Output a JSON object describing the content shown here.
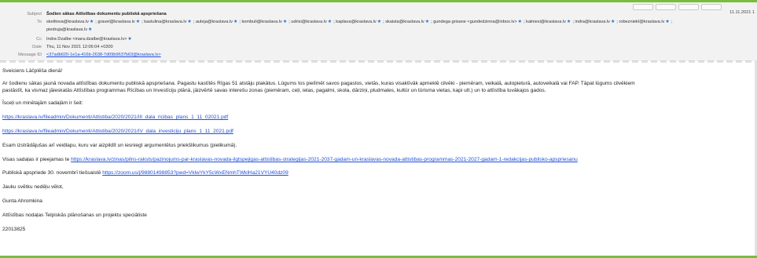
{
  "header": {
    "subject_label": "Subject",
    "subject": "Šodien sākas Attīstības dokumentu publiskā apspriešana",
    "date_right": "11.11.2021 1",
    "to_label": "To",
    "to_recipients": [
      "skelitova@kraslava.lv",
      "gravel@kraslava.lv",
      "kastulina@kraslava.lv",
      "auleja@kraslava.lv",
      "kombuli@kraslava.lv",
      "udrisi@kraslava.lv",
      "kaplava@kraslava.lv",
      "skaista@kraslava.lv",
      "gundega grisane <gundedzinna@inbox.lv>",
      "kalniesi@kraslava.lv",
      "indra@kraslava.lv",
      "robezniekI@kraslava.lv"
    ],
    "to_recipients_line2": [
      "piedruja@kraslava.lv"
    ],
    "cc_label": "Cc",
    "cc_value": "Indra Dzalbe <inara.dzalbe@kraslava.lv>",
    "date_label": "Date",
    "date_value": "Thu, 11 Nov 2021 12:06:04 +0200",
    "message_id_label": "Message ID",
    "message_id_value": "<37adb620-1e1a-416b-2638-7d09b9637b63@kraslava.lv>"
  },
  "body": {
    "greeting": "Sveiciens Lāčplēša dienā!",
    "para1_line1": "Ar šodienu sākas jaunā novada attīstības dokumentu publiskā apspriešana. Pagastu kastītēs Rīgas 51 atstāju plakātus. Lūgums tos pielīmēt savos pagastos, vietās, kuras visaktīvāk apmeklē cilvēki - piemēram,  veikalā, autopieturā, autoveikalā vai FAP. Tāpat lūgums cilvēkiem",
    "para1_line2": "pastāstīt, ka vismaz jāieskatās Attīstības programmas Rīcības un Investīciju plānā, jāizvērtē savas intereš­u zonas (piemēram, ceļi, ielas, pagalmi, skola, dārziņi, pludmales, kultūr un tūrisma vietas, kapi utt.) un to attīstība tuvākajos gados.",
    "short_intro": "Īsceļi un minētajām sadaļām ir šeit:",
    "link1": "https://kraslava.lv/fileadmin/Dokumenti/Attistiba/2020/2021/III_dala_ricibas_plans_1_11_02021.pdf",
    "link2": "https://kraslava.lv/fileadmin/Dokumenti/Attistiba/2020/2021/IV_dala_investiciju_plans_1_11_2021.pdf",
    "para2": "Esam izstrādājušas arī veidlapu, kuru var aizpildīt un iesniegt argumentētus priekšlikumus (pielikumā).",
    "visas_prefix": "Visas sadaļas ir pieejamas te ",
    "link3": "https://kraslava.lv/zinas/pilns-raksts/pazinojums-par-kraslavas-novada-ilgtspejigas-attistibas-strategijas-2021-2037-gadam-un-kraslavas-novada-attistibas-programmas-2021-2027-gadam-1-redakcijas-publisko-apspriesanu",
    "publiska_prefix": "Publiskā apspriede 30. novembrī tiešsaistē ",
    "link4": "https://zoom.us/j/98801498853?pwd=VklwYkY5cWxENmhTWklHa21VYU40dz09",
    "closing": "Jauku svētku nedēļu vēlot,",
    "sig_name": "Gunta Ahromkina",
    "sig_title": "Attīstības nodaļas Telpiskās plānošanas un projektu speciāliste",
    "sig_phone": "22013825"
  },
  "colors": {
    "frame_border": "#78bd3e",
    "link": "#1f4fd8",
    "star": "#1f70c8",
    "header_bg": "#f2f2f2"
  },
  "icons": [
    "star-icon"
  ]
}
